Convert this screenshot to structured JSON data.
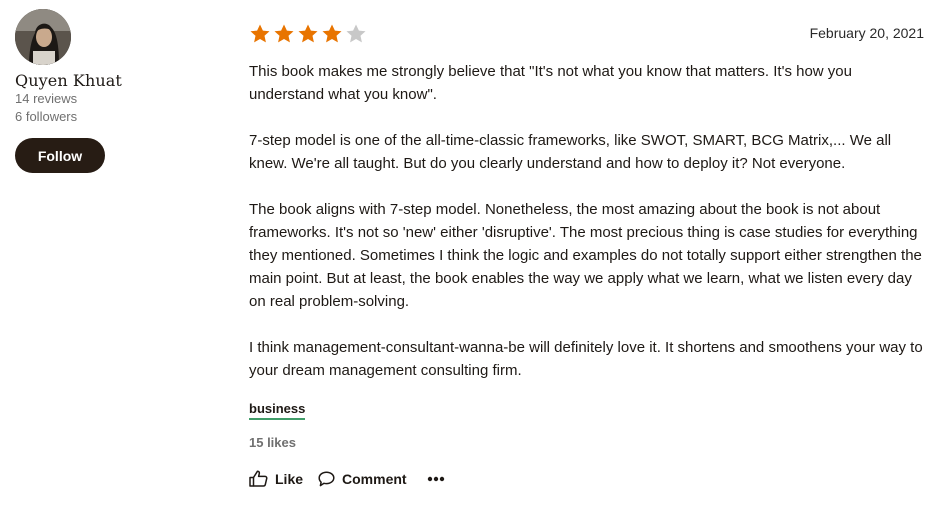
{
  "reviewer": {
    "name": "Quyen Khuat",
    "reviews": "14 reviews",
    "followers": "6 followers",
    "follow_label": "Follow"
  },
  "review": {
    "rating": 4,
    "rating_max": 5,
    "date": "February 20, 2021",
    "paragraphs": [
      "This book makes me strongly believe that \"It's not what you know that matters. It's how you understand what you know\".",
      "7-step model is one of the all-time-classic frameworks, like SWOT, SMART, BCG Matrix,... We all knew. We're all taught. But do you clearly understand and how to deploy it? Not everyone.",
      "The book aligns with 7-step model. Nonetheless, the most amazing about the book is not about frameworks. It's not so 'new' either 'disruptive'. The most precious thing is case studies for everything they mentioned. Sometimes I think the logic and examples do not totally support either strengthen the main point. But at least, the book enables the way we apply what we learn, what we listen every day on real problem-solving.",
      "I think management-consultant-wanna-be will definitely love it. It shortens and smoothens your way to your dream management consulting firm."
    ],
    "shelf": "business",
    "likes": "15 likes"
  },
  "actions": {
    "like_label": "Like",
    "comment_label": "Comment",
    "more_icon": "more-dots-icon"
  },
  "colors": {
    "star_filled": "#e87400",
    "star_empty": "#c8c8c8",
    "button_dark": "#271c14",
    "shelf_underline": "#409d69",
    "muted_text": "#707070"
  }
}
